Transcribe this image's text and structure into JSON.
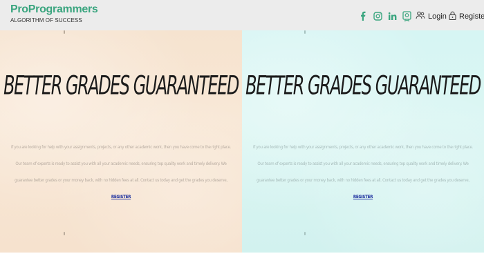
{
  "brand": {
    "name": "ProProgrammers",
    "tagline": "ALGORITHM OF SUCCESS"
  },
  "social_icons": [
    "facebook-icon",
    "instagram-icon",
    "linkedin-icon",
    "certificate-icon"
  ],
  "auth": {
    "login_label": "Login",
    "register_label": "Register"
  },
  "panels": [
    {
      "headline": "BETTER GRADES GUARANTEED",
      "paragraph_line1": "If you are looking for help with your assignments, projects, or any other academic work, then you have come to the right place. Our team of experts is ready to",
      "paragraph_line2": "assist you with all your academic needs, ensuring top quality work and timely delivery. We guarantee better grades or your money back, with no hidden fees",
      "paragraph_line3": "at all. Contact us today and get the grades you deserve,",
      "link_label": "REGISTER",
      "bg": "#f7e5d2"
    },
    {
      "headline": "BETTER GRADES GUARANTEED",
      "paragraph_line1": "If you are looking for help with your assignments, projects, or any other academic work, then you have come to the right place. Our team of experts is ready to",
      "paragraph_line2": "assist you with all your academic needs, ensuring top quality work and timely delivery. We guarantee better grades or your money back, with no hidden fees",
      "paragraph_line3": "at all. Contact us today and get the grades you deserve,",
      "link_label": "REGISTER",
      "bg": "#d7f5f2"
    }
  ],
  "colors": {
    "brand": "#3aa57f",
    "topbar": "#ececec"
  }
}
